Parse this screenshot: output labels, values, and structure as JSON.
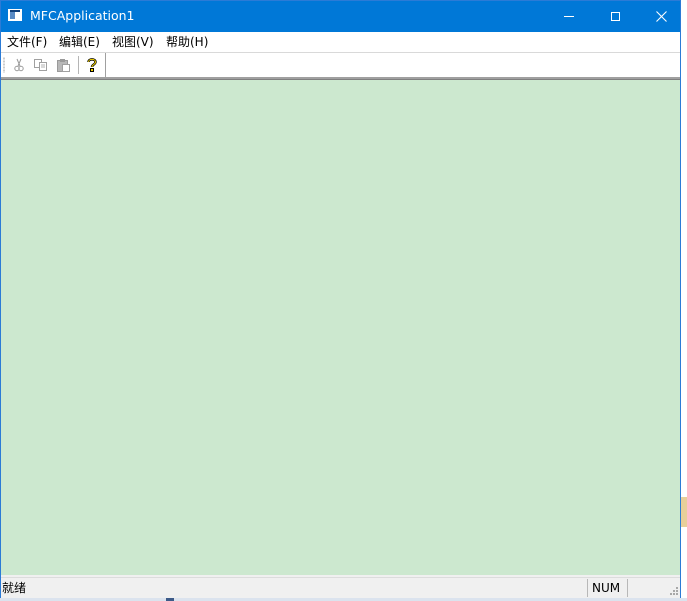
{
  "window": {
    "title": "MFCApplication1",
    "controls": {
      "minimize": "minimize-icon",
      "maximize": "maximize-icon",
      "close": "close-icon"
    }
  },
  "menu": {
    "items": [
      {
        "label": "文件(F)"
      },
      {
        "label": "编辑(E)"
      },
      {
        "label": "视图(V)"
      },
      {
        "label": "帮助(H)"
      }
    ]
  },
  "toolbar": {
    "buttons": [
      {
        "icon": "cut-icon",
        "enabled": false
      },
      {
        "icon": "copy-icon",
        "enabled": false
      },
      {
        "icon": "paste-icon",
        "enabled": false
      },
      {
        "icon": "help-icon",
        "enabled": true
      }
    ]
  },
  "view": {
    "background": "#cce8cf"
  },
  "statusbar": {
    "text": "就绪",
    "panes": [
      {
        "label": "NUM"
      },
      {
        "label": ""
      }
    ]
  },
  "colors": {
    "titlebar": "#0078d7",
    "client": "#cce8cf"
  }
}
